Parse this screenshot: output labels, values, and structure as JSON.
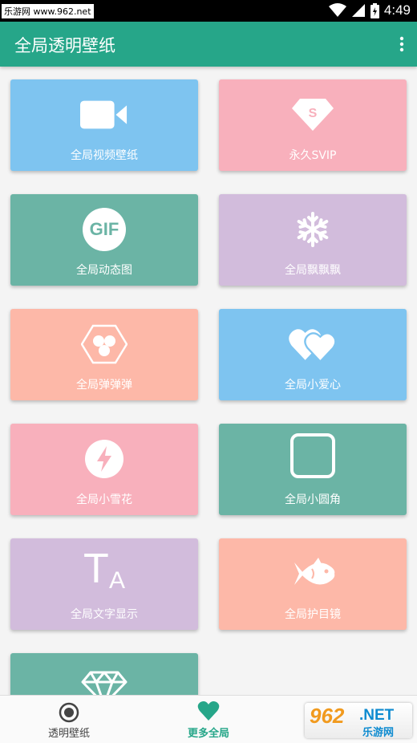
{
  "status_bar": {
    "watermark": "乐游网 www.962.net",
    "time": "4:49"
  },
  "app_bar": {
    "title": "全局透明壁纸",
    "more_icon": "more-vert-icon"
  },
  "tiles": [
    {
      "label": "全局视频壁纸",
      "icon": "video-camera-icon",
      "color": "#7ec4f0"
    },
    {
      "label": "永久SVIP",
      "icon": "svip-shield-icon",
      "color": "#f8b0bc"
    },
    {
      "label": "全局动态图",
      "icon": "gif-icon",
      "icon_text": "GIF",
      "color": "#6bb4a5"
    },
    {
      "label": "全局飘飘飘",
      "icon": "snowflake-icon",
      "color": "#d2bcdc"
    },
    {
      "label": "全局弹弹弹",
      "icon": "hexagon-bubbles-icon",
      "color": "#fdb8a8"
    },
    {
      "label": "全局小爱心",
      "icon": "hearts-icon",
      "color": "#7ec4f0"
    },
    {
      "label": "全局小雪花",
      "icon": "lightning-circle-icon",
      "color": "#f8b0bc"
    },
    {
      "label": "全局小圆角",
      "icon": "rounded-square-icon",
      "color": "#6bb4a5"
    },
    {
      "label": "全局文字显示",
      "icon": "text-size-icon",
      "icon_text_big": "T",
      "icon_text_small": "A",
      "color": "#d2bcdc"
    },
    {
      "label": "全局护目镜",
      "icon": "fish-icon",
      "color": "#fdb8a8"
    },
    {
      "label": "",
      "icon": "diamond-icon",
      "color": "#6bb4a5"
    }
  ],
  "bottom_nav": {
    "items": [
      {
        "label": "透明壁纸",
        "icon": "radio-circle-icon",
        "color": "#444444"
      },
      {
        "label": "更多全局",
        "icon": "heart-icon",
        "color": "#26a689"
      }
    ]
  },
  "logo": {
    "number": "962",
    "suffix": ".NET",
    "name": "乐游网"
  }
}
